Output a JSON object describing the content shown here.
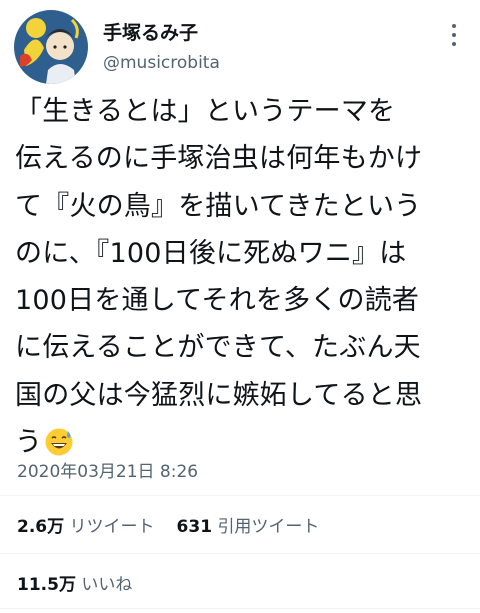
{
  "user": {
    "display_name": "手塚るみ子",
    "handle": "@musicrobita"
  },
  "tweet": {
    "lines": [
      "「生きるとは」というテーマを",
      "伝えるのに手塚治虫は何年もかけ",
      "て『火の鳥』を描いてきたという",
      "のに、『100日後に死ぬワニ』は",
      "100日を通してそれを多くの読者",
      "に伝えることができて、たぶん天",
      "国の父は今猛烈に嫉妬してると思",
      "う"
    ],
    "emoji": "grinning-sweat-emoji",
    "timestamp": "2020年03月21日 8:26"
  },
  "stats": {
    "retweets_count": "2.6万",
    "retweets_label": "リツイート",
    "quotes_count": "631",
    "quotes_label": "引用ツイート",
    "likes_count": "11.5万",
    "likes_label": "いいね"
  },
  "colors": {
    "text": "#0f1419",
    "secondary": "#536471",
    "divider": "#eff3f4",
    "avatar_bg": "#2f5f8f"
  }
}
